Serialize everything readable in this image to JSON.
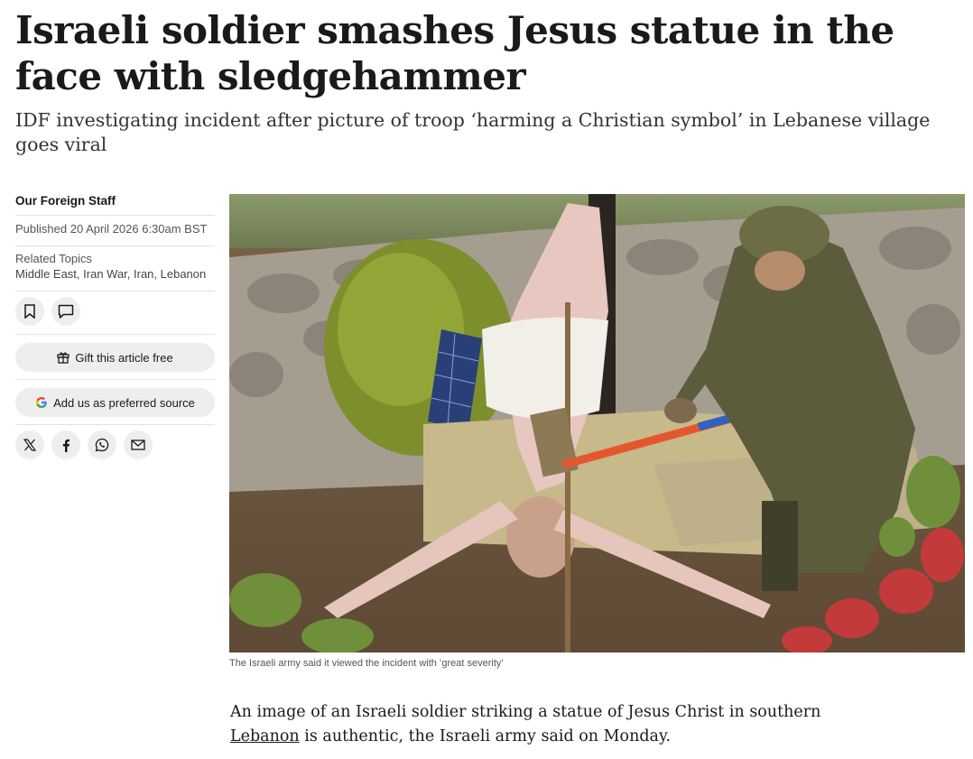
{
  "article": {
    "headline": "Israeli soldier smashes Jesus statue in the face with sledgehammer",
    "standfirst": "IDF investigating incident after picture of troop ‘harming a Christian symbol’ in Lebanese village goes viral",
    "byline": "Our Foreign Staff",
    "published": "Published 20 April 2026 6:30am BST",
    "related_label": "Related Topics",
    "related_topics": "Middle East, Iran War, Iran, Lebanon",
    "caption": "The Israeli army said it viewed the incident with ‘great severity’",
    "body_before": "An image of an Israeli soldier striking a statue of Jesus Christ in southern ",
    "body_link": "Lebanon",
    "body_after": " is authentic, the Israeli army said on Monday."
  },
  "actions": {
    "gift_label": "Gift this article free",
    "preferred_label": "Add us as preferred source"
  },
  "icons": {
    "save": "bookmark-icon",
    "comment": "comment-icon",
    "gift": "gift-icon",
    "google": "google-icon",
    "x": "x-icon",
    "facebook": "facebook-icon",
    "whatsapp": "whatsapp-icon",
    "email": "email-icon"
  },
  "colors": {
    "text": "#1a1a1a",
    "muted": "#555555",
    "button_bg": "#eeeeee"
  }
}
